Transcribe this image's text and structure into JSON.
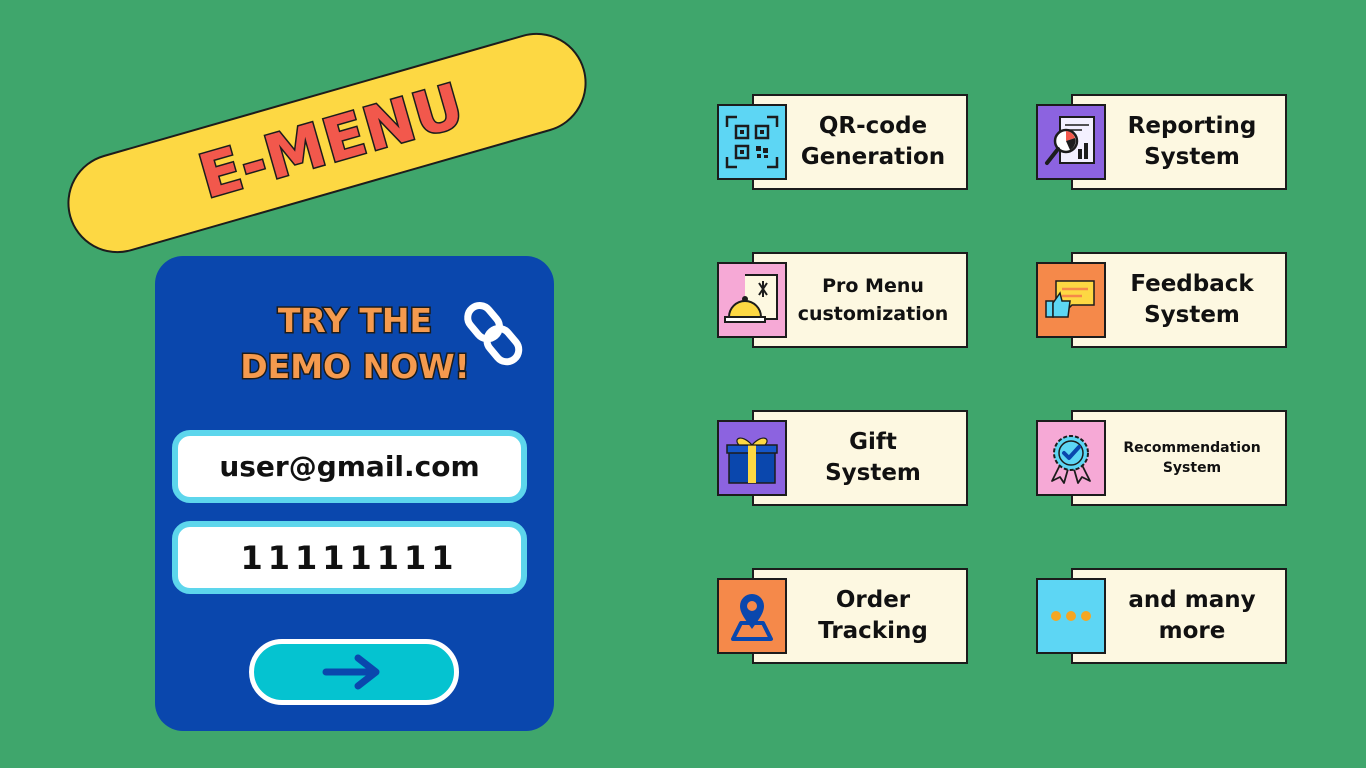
{
  "brand": {
    "title": "E-MENU"
  },
  "demo": {
    "cta_line1": "TRY THE",
    "cta_line2": "DEMO NOW!",
    "email_value": "user@gmail.com",
    "password_value": "11111111",
    "submit_icon": "arrow-right-icon"
  },
  "colors": {
    "background": "#3fa66c",
    "pill": "#fdd843",
    "title": "#f2584c",
    "card": "#0a47ad",
    "field_border": "#5dd6ec",
    "button": "#05c3d0",
    "feature_card": "#fdf8e1"
  },
  "features": [
    {
      "label": "QR-code\nGeneration",
      "icon": "qr-code-icon",
      "icon_bg": "#5dd6f4"
    },
    {
      "label": "Reporting\nSystem",
      "icon": "report-magnifier-icon",
      "icon_bg": "#8c63e0"
    },
    {
      "label": "Pro Menu\ncustomization",
      "icon": "menu-cloche-icon",
      "icon_bg": "#f6a9d6"
    },
    {
      "label": "Feedback\nSystem",
      "icon": "feedback-thumbs-icon",
      "icon_bg": "#f5894a"
    },
    {
      "label": "Gift\nSystem",
      "icon": "gift-box-icon",
      "icon_bg": "#8c63e0"
    },
    {
      "label": "Recommendation\nSystem",
      "icon": "badge-check-icon",
      "icon_bg": "#f6a9d6"
    },
    {
      "label": "Order\nTracking",
      "icon": "map-pin-icon",
      "icon_bg": "#f5894a"
    },
    {
      "label": "and many\nmore",
      "icon": "dots-icon",
      "icon_bg": "#5dd6f4"
    }
  ]
}
